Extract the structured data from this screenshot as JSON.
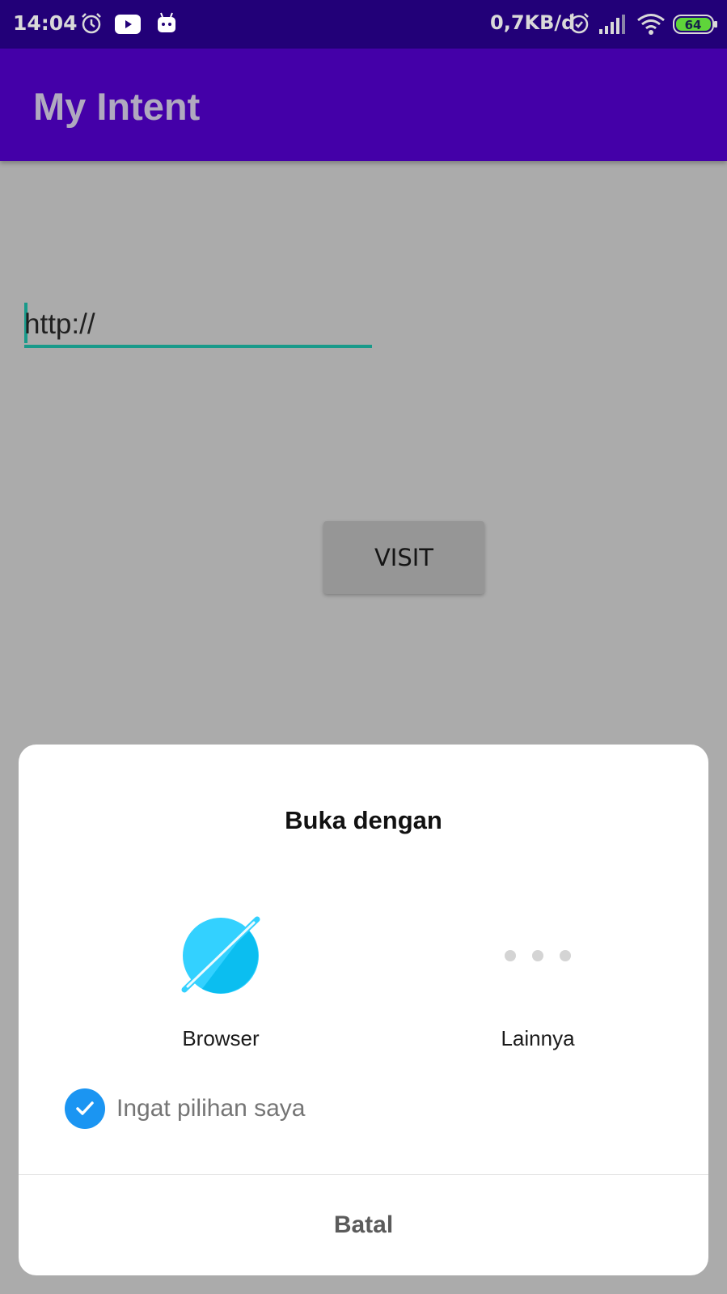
{
  "status_bar": {
    "time": "14:04",
    "network_speed": "0,7KB/d",
    "battery": "64",
    "icons": [
      "alarm-icon",
      "youtube-icon",
      "android-bot-icon",
      "alarm-icon",
      "signal-icon",
      "wifi-icon",
      "battery-icon"
    ]
  },
  "app_bar": {
    "title": "My Intent"
  },
  "url_field": {
    "value": "http://"
  },
  "visit_button": {
    "label": "VISIT"
  },
  "chooser_dialog": {
    "title": "Buka dengan",
    "options": [
      {
        "label": "Browser",
        "icon": "browser-planet-icon"
      },
      {
        "label": "Lainnya",
        "icon": "more-dots-icon"
      }
    ],
    "remember_choice": {
      "label": "Ingat pilihan saya",
      "checked": true
    },
    "cancel_label": "Batal"
  },
  "colors": {
    "status_bar": "#220078",
    "app_bar": "#4400a8",
    "accent": "#199a8a",
    "scrim": "#ababab",
    "checkbox": "#1b95f2"
  }
}
